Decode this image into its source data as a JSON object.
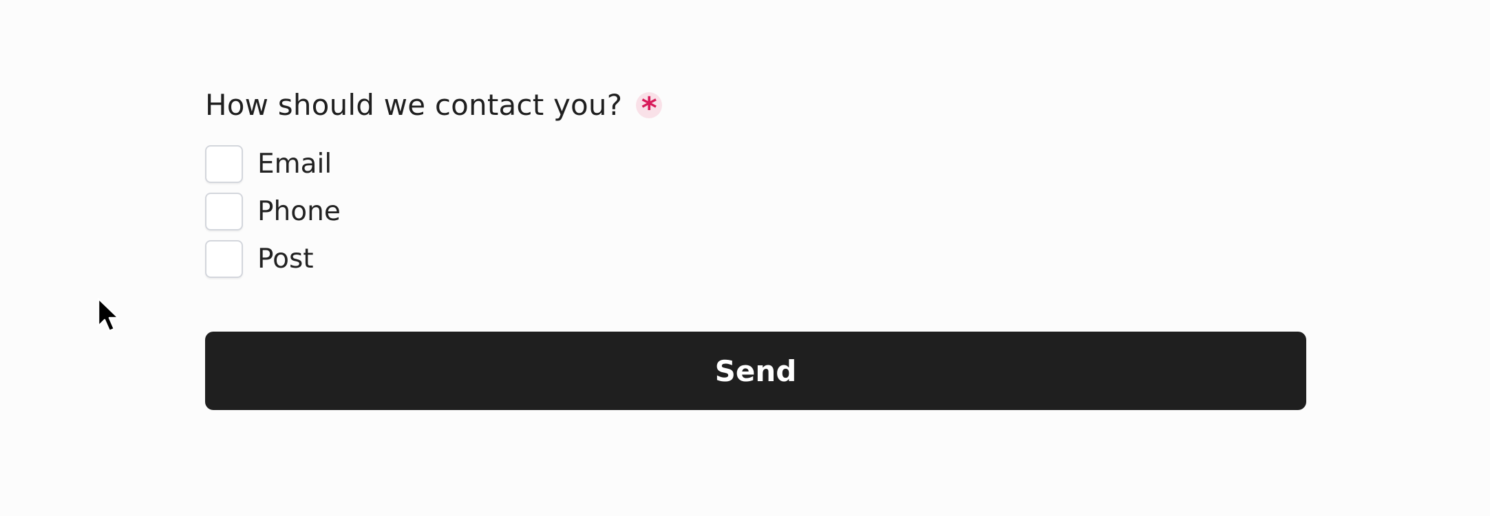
{
  "form": {
    "question": "How should we contact you?",
    "required_marker": "*",
    "options": [
      {
        "label": "Email",
        "checked": false
      },
      {
        "label": "Phone",
        "checked": false
      },
      {
        "label": "Post",
        "checked": false
      }
    ],
    "submit_label": "Send"
  },
  "colors": {
    "background": "#fcfcfc",
    "button": "#1f1f1f",
    "required_accent": "#d81b5a",
    "required_bg": "#f9e1e8",
    "checkbox_border": "#d3d6dc"
  },
  "icons": {
    "cursor": "arrow-cursor-icon"
  }
}
